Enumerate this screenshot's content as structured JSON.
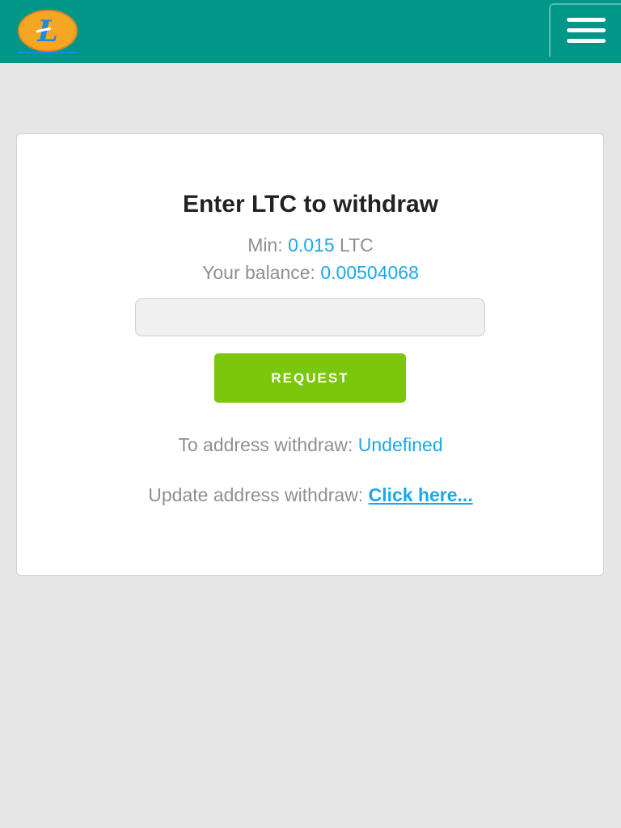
{
  "header": {
    "logo_letter": "L",
    "menu_icon": "hamburger-menu-icon",
    "colors": {
      "background": "#009688",
      "logo_fill": "#f5a623",
      "logo_accent": "#1e88e5"
    }
  },
  "withdraw": {
    "title": "Enter LTC to withdraw",
    "min_label": "Min:",
    "min_value": "0.015",
    "min_unit": "LTC",
    "balance_label": "Your balance:",
    "balance_value": "0.00504068",
    "amount_value": "",
    "amount_placeholder": "",
    "request_label": "REQUEST",
    "to_address_label": "To address withdraw:",
    "to_address_value": "Undefined",
    "update_label": "Update address withdraw:",
    "update_link": "Click here..."
  },
  "colors": {
    "accent": "#1ea7e8",
    "request_button": "#7ac70c",
    "text_muted": "#8f8f8f",
    "page_background": "#e6e6e6"
  }
}
